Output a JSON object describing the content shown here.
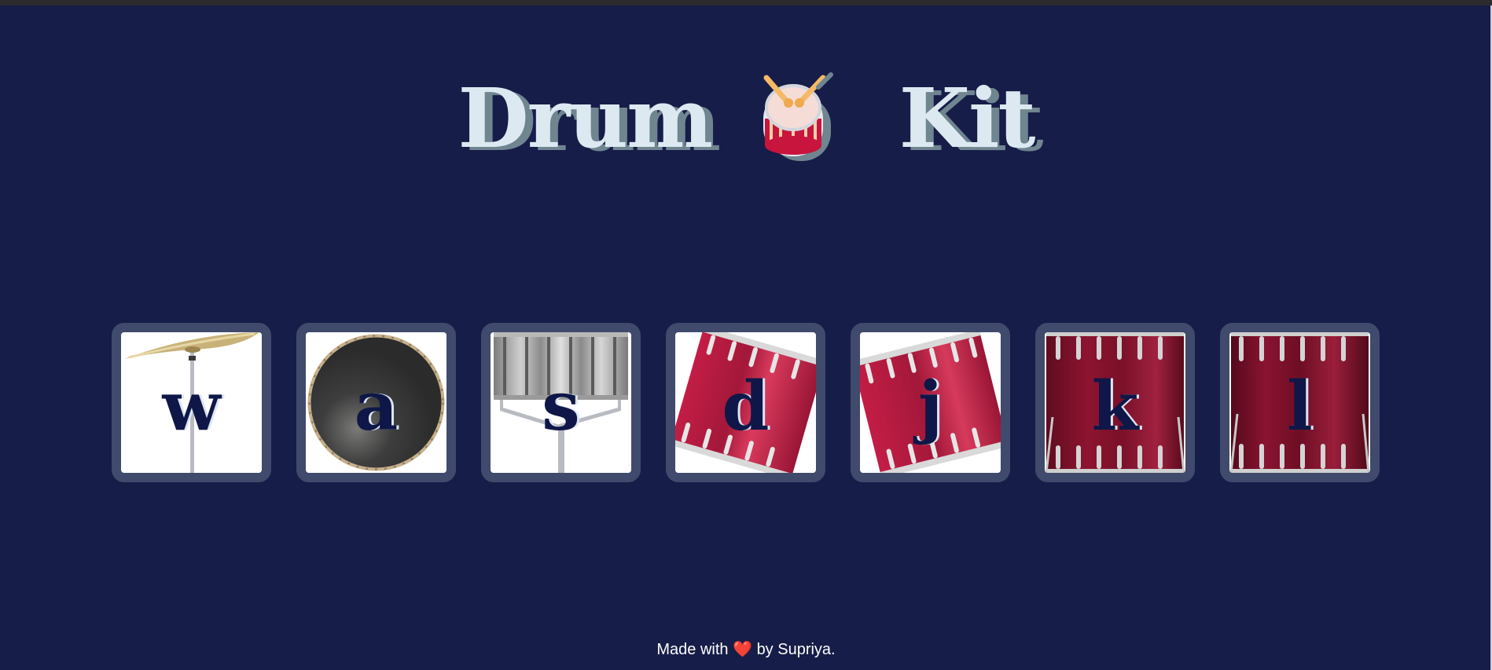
{
  "page": {
    "title_left": "Drum",
    "title_right": "Kit",
    "title_icon": "drum-with-sticks-icon"
  },
  "drums": [
    {
      "key": "w",
      "icon": "crash-cymbal-icon"
    },
    {
      "key": "a",
      "icon": "bass-drum-icon"
    },
    {
      "key": "s",
      "icon": "snare-drum-icon"
    },
    {
      "key": "d",
      "icon": "tom1-icon"
    },
    {
      "key": "j",
      "icon": "tom2-icon"
    },
    {
      "key": "k",
      "icon": "tom3-icon"
    },
    {
      "key": "l",
      "icon": "tom4-icon"
    }
  ],
  "footer": {
    "prefix": "Made with",
    "heart": "❤️",
    "suffix": "by Supriya."
  },
  "colors": {
    "background": "#161d48",
    "title": "#dde9f1",
    "title_shadow": "#6f8590",
    "key_text": "#0f1748",
    "drum_border": "#404a6c",
    "drum_red": "#b01b3a"
  }
}
